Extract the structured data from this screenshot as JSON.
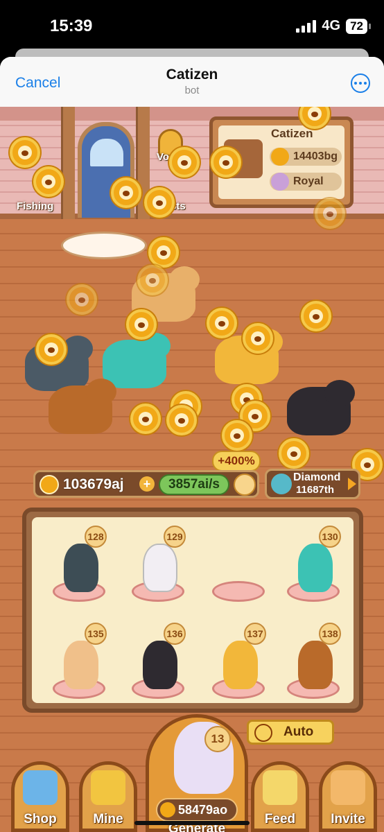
{
  "status": {
    "time": "15:39",
    "network": "4G",
    "battery": "72"
  },
  "header": {
    "cancel_label": "Cancel",
    "title": "Catizen",
    "subtitle": "bot"
  },
  "room": {
    "fishing_label": "Fishing",
    "vote_label": "Vo",
    "quests_label": "sts"
  },
  "profile_sign": {
    "name": "Catizen",
    "balance": "14403bg",
    "league": "Royal"
  },
  "economy": {
    "balance": "103679aj",
    "rate": "3857ai/s",
    "boost": "+400%"
  },
  "rank": {
    "tier": "Diamond",
    "position": "11687th"
  },
  "board": {
    "slots": [
      {
        "level": "128",
        "cat_color": "#3d4d55"
      },
      {
        "level": "129",
        "cat_color": "#f2eef3"
      },
      {
        "level": "",
        "cat_color": ""
      },
      {
        "level": "130",
        "cat_color": "#3cc2b4"
      },
      {
        "level": "135",
        "cat_color": "#f0c08a"
      },
      {
        "level": "136",
        "cat_color": "#2e2a30"
      },
      {
        "level": "137",
        "cat_color": "#f2b73a"
      },
      {
        "level": "138",
        "cat_color": "#b96a2a"
      }
    ]
  },
  "generator": {
    "level": "13",
    "cost": "58479ao",
    "label": "Generate"
  },
  "auto": {
    "label": "Auto"
  },
  "nav": {
    "shop": "Shop",
    "mine": "Mine",
    "feed": "Feed",
    "invite": "Invite"
  },
  "colors": {
    "accent": "#1a7fe8",
    "coin": "#f1a817",
    "floor": "#c97a4a",
    "wall": "#e9b9b5"
  }
}
